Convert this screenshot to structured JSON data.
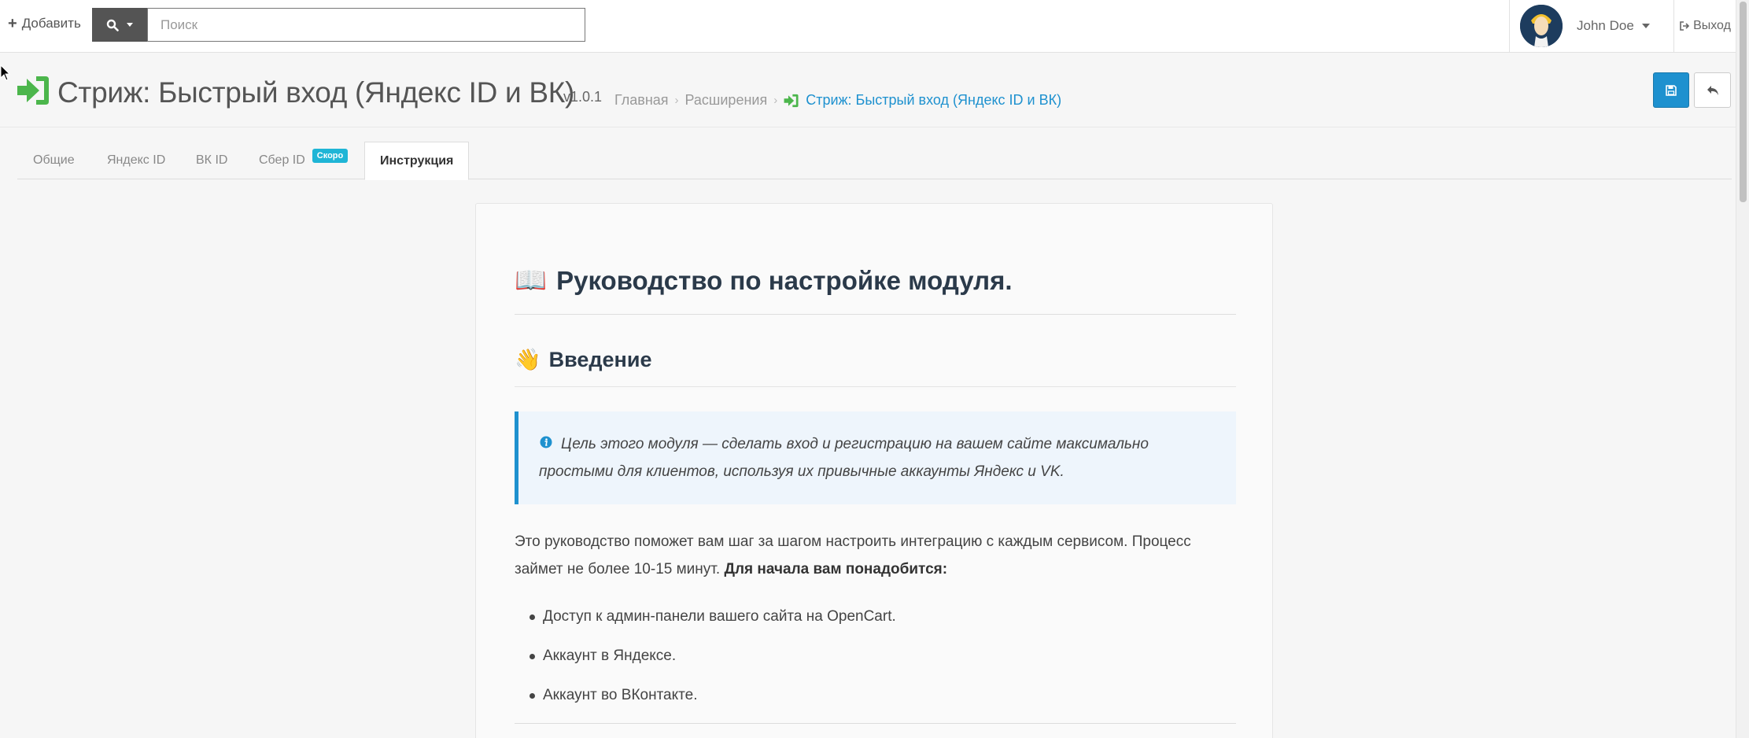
{
  "header": {
    "add_label": "Добавить",
    "search_placeholder": "Поиск",
    "user_name": "John Doe",
    "logout_label": "Выход"
  },
  "page": {
    "title": "Стриж: Быстрый вход (Яндекс ID и ВК)",
    "version": "v1.0.1",
    "breadcrumbs": [
      "Главная",
      "Расширения",
      "Стриж: Быстрый вход (Яндекс ID и ВК)"
    ]
  },
  "tabs": [
    {
      "label": "Общие"
    },
    {
      "label": "Яндекс ID"
    },
    {
      "label": "ВК ID"
    },
    {
      "label": "Сбер ID",
      "badge": "Скоро"
    },
    {
      "label": "Инструкция",
      "active": true
    }
  ],
  "content": {
    "h1_emoji": "📖",
    "h1": "Руководство по настройке модуля.",
    "h2_emoji": "👋",
    "h2": "Введение",
    "callout": "Цель этого модуля — сделать вход и регистрацию на вашем сайте максимально простыми для клиентов, используя их привычные аккаунты Яндекс и VK.",
    "para_text": "Это руководство поможет вам шаг за шагом настроить интеграцию с каждым сервисом. Процесс займет не более 10-15 минут.",
    "para_bold": "Для начала вам понадобится:",
    "list": [
      "Доступ к админ-панели вашего сайта на OpenCart.",
      "Аккаунт в Яндексе.",
      "Аккаунт во ВКонтакте."
    ]
  },
  "colors": {
    "primary": "#1e91cf",
    "accent_green": "#4cb64c",
    "badge": "#1fb5d6",
    "search_button": "#545454"
  },
  "icons": [
    "plus-icon",
    "search-icon",
    "caret-down-icon",
    "signout-icon",
    "sign-in-icon",
    "save-icon",
    "reply-icon",
    "info-icon"
  ]
}
